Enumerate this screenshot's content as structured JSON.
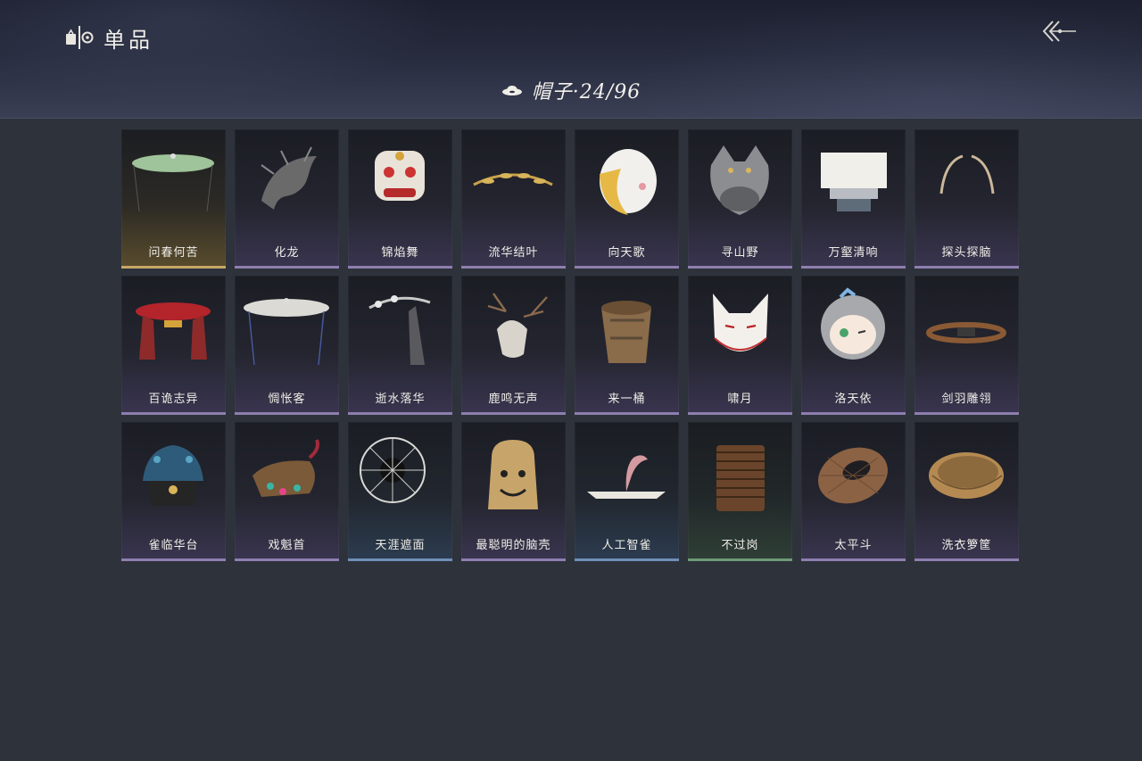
{
  "header": {
    "title": "单品",
    "title_icon": "wardrobe-icon",
    "back_icon": "back-arrow-icon"
  },
  "category": {
    "icon": "hat-icon",
    "label": "帽子·24/96"
  },
  "colors": {
    "background": "#2e323b",
    "header": "#262a3c",
    "rarity_purple": "#8e7fb0",
    "rarity_gold": "#c6a865",
    "rarity_blue": "#6f8fb7",
    "rarity_green": "#6e9a78"
  },
  "items": [
    {
      "name": "问春何苦",
      "rarity": "gold",
      "icon": "bamboo-veil-hat-icon"
    },
    {
      "name": "化龙",
      "rarity": "purple",
      "icon": "dragon-headdress-icon"
    },
    {
      "name": "锦焰舞",
      "rarity": "purple",
      "icon": "lion-dance-head-icon"
    },
    {
      "name": "流华结叶",
      "rarity": "purple",
      "icon": "golden-leaf-circlet-icon"
    },
    {
      "name": "向天歌",
      "rarity": "purple",
      "icon": "goose-hood-icon"
    },
    {
      "name": "寻山野",
      "rarity": "purple",
      "icon": "wolf-pelt-hood-icon"
    },
    {
      "name": "万壑清响",
      "rarity": "purple",
      "icon": "white-cloth-crown-icon"
    },
    {
      "name": "探头探脑",
      "rarity": "purple",
      "icon": "feather-antennae-icon"
    },
    {
      "name": "百诡志异",
      "rarity": "purple",
      "icon": "red-canopy-hat-icon"
    },
    {
      "name": "惆怅客",
      "rarity": "purple",
      "icon": "white-veil-hat-icon"
    },
    {
      "name": "逝水落华",
      "rarity": "purple",
      "icon": "veiled-hairpiece-icon"
    },
    {
      "name": "鹿鸣无声",
      "rarity": "purple",
      "icon": "deer-skull-icon"
    },
    {
      "name": "来一桶",
      "rarity": "purple",
      "icon": "wooden-bucket-icon"
    },
    {
      "name": "啸月",
      "rarity": "purple",
      "icon": "fox-mask-icon"
    },
    {
      "name": "洛天依",
      "rarity": "purple",
      "icon": "chibi-head-icon"
    },
    {
      "name": "剑羽雕翎",
      "rarity": "purple",
      "icon": "leather-headband-icon"
    },
    {
      "name": "雀临华台",
      "rarity": "purple",
      "icon": "phoenix-crown-icon"
    },
    {
      "name": "戏魁首",
      "rarity": "purple",
      "icon": "opera-headdress-icon"
    },
    {
      "name": "天涯遮面",
      "rarity": "blue",
      "icon": "wire-frame-hat-icon"
    },
    {
      "name": "最聪明的脑壳",
      "rarity": "purple",
      "icon": "bell-helmet-icon"
    },
    {
      "name": "人工智雀",
      "rarity": "blue",
      "icon": "bird-hat-icon"
    },
    {
      "name": "不过岗",
      "rarity": "green",
      "icon": "stacked-bowls-icon"
    },
    {
      "name": "太平斗",
      "rarity": "purple",
      "icon": "bamboo-basket-hat-icon"
    },
    {
      "name": "洗衣箩筐",
      "rarity": "purple",
      "icon": "wicker-basket-icon"
    }
  ]
}
